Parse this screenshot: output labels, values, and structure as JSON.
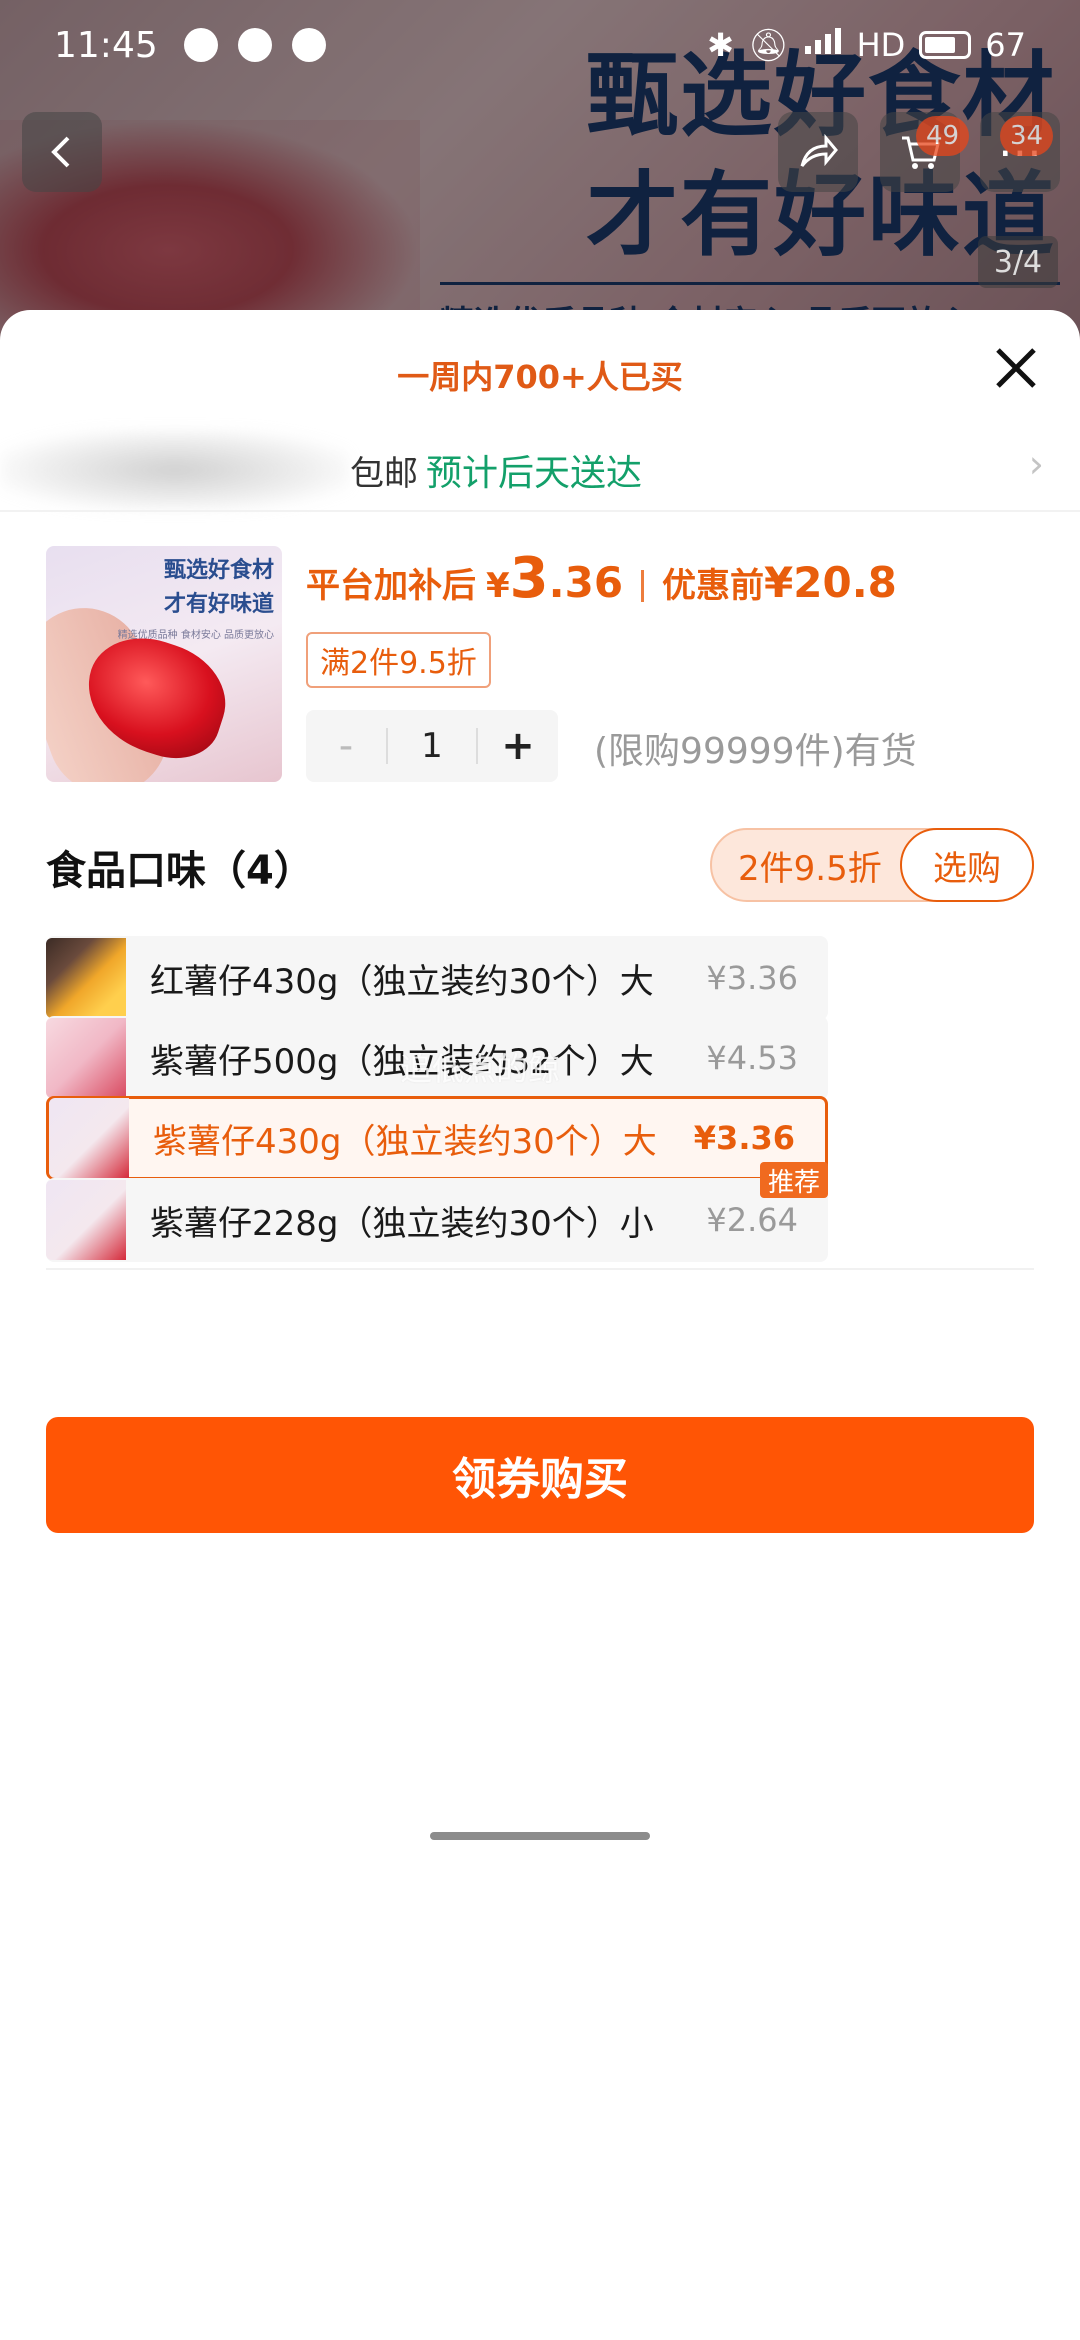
{
  "status_bar": {
    "time": "11:45",
    "network": "HD",
    "battery": "67"
  },
  "background": {
    "slogan_line1": "甄选好食材",
    "slogan_line2": "才有好味道",
    "subline": "精选优质品种 食材安心 品质更放心",
    "badge_left": "49",
    "badge_right": "34",
    "pager": "3/4"
  },
  "sheet": {
    "sold_banner": "一周内700+人已买",
    "shipping": {
      "free_text": "包邮",
      "eta": "预计后天送达"
    },
    "product": {
      "thumb_line1": "甄选好食材",
      "thumb_line2": "才有好味道",
      "thumb_sub": "精选优质品种 食材安心 品质更放心",
      "subsidy_label": "平台加补后",
      "yen": "¥",
      "price_int": "3",
      "price_dec": ".36",
      "orig_label": "优惠前",
      "orig_price": "¥20.8",
      "deal_tag": "满2件9.5折"
    },
    "quantity": {
      "minus": "-",
      "value": "1",
      "plus": "+",
      "stock_note": "(限购99999件)有货"
    },
    "variants_section": {
      "title": "食品口味（4）",
      "promo_text": "2件9.5折",
      "promo_button": "选购"
    },
    "variants": [
      {
        "name": "红薯仔430g（独立装约30个）大",
        "price": "¥3.36",
        "selected": false
      },
      {
        "name": "紫薯仔500g（独立装约32个）大",
        "price": "¥4.53",
        "selected": false
      },
      {
        "name": "紫薯仔430g（独立装约30个）大",
        "price": "¥3.36",
        "selected": true
      },
      {
        "name": "紫薯仔228g（独立装约30个）小",
        "price": "¥2.64",
        "selected": false,
        "badge": "推荐"
      }
    ],
    "watermark": "追低点的鲸",
    "buy_button": "领券购买"
  },
  "colors": {
    "accent": "#ff5505",
    "price": "#e85d0c",
    "eta_green": "#13a06a"
  }
}
